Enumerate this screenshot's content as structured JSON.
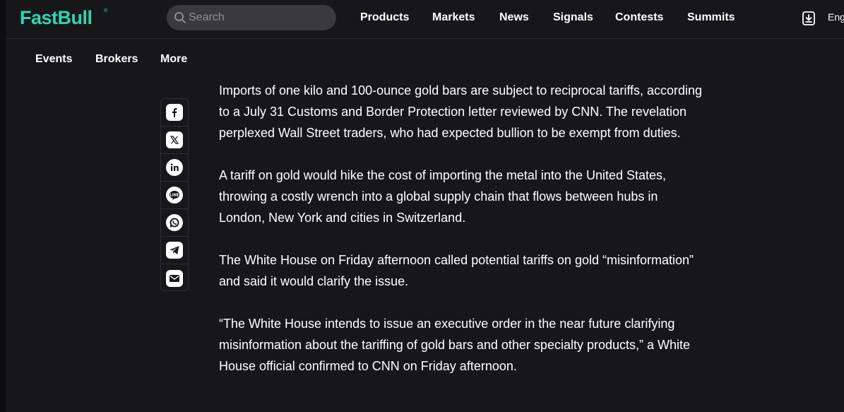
{
  "brand": {
    "name": "FastBull",
    "registered_mark": "®",
    "accent_color": "#2fd5b0"
  },
  "search": {
    "placeholder": "Search"
  },
  "nav": {
    "items": [
      "Products",
      "Markets",
      "News",
      "Signals",
      "Contests",
      "Summits"
    ]
  },
  "language": {
    "label": "Eng"
  },
  "secondary_nav": {
    "items": [
      "Events",
      "Brokers",
      "More"
    ]
  },
  "share": {
    "icons": [
      "facebook-icon",
      "x-icon",
      "linkedin-icon",
      "line-icon",
      "whatsapp-icon",
      "telegram-icon",
      "email-icon"
    ]
  },
  "article": {
    "paragraphs": [
      "Imports of one kilo and 100-ounce gold bars are subject to reciprocal tariffs, according to a July 31 Customs and Border Protection letter reviewed by CNN. The revelation perplexed Wall Street traders, who had expected bullion to be exempt from duties.",
      "A tariff on gold would hike the cost of importing the metal into the United States, throwing a costly wrench into a global supply chain that flows between hubs in London, New York and cities in Switzerland.",
      "The White House on Friday afternoon called potential tariffs on gold “misinformation” and said it would clarify the issue.",
      "“The White House intends to issue an executive order in the near future clarifying misinformation about the tariffing of gold bars and other specialty products,” a White House official confirmed to CNN on Friday afternoon."
    ]
  }
}
